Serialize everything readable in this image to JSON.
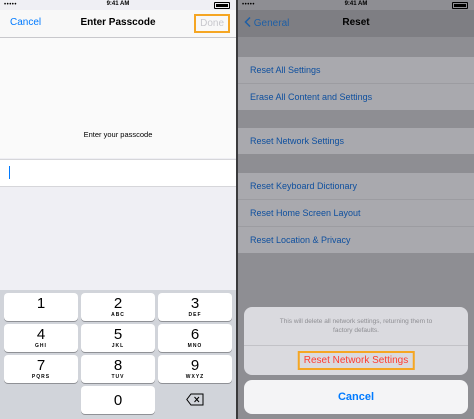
{
  "left": {
    "status": {
      "carrier": "•••••",
      "time": "9:41 AM"
    },
    "nav": {
      "cancel": "Cancel",
      "title": "Enter Passcode",
      "done": "Done"
    },
    "prompt": "Enter your passcode",
    "keys": [
      {
        "num": "1",
        "letters": ""
      },
      {
        "num": "2",
        "letters": "ABC"
      },
      {
        "num": "3",
        "letters": "DEF"
      },
      {
        "num": "4",
        "letters": "GHI"
      },
      {
        "num": "5",
        "letters": "JKL"
      },
      {
        "num": "6",
        "letters": "MNO"
      },
      {
        "num": "7",
        "letters": "PQRS"
      },
      {
        "num": "8",
        "letters": "TUV"
      },
      {
        "num": "9",
        "letters": "WXYZ"
      },
      {
        "num": "0",
        "letters": ""
      }
    ]
  },
  "right": {
    "status": {
      "carrier": "•••••",
      "time": "9:41 AM"
    },
    "nav": {
      "back": "General",
      "title": "Reset"
    },
    "group1": [
      "Reset All Settings",
      "Erase All Content and Settings"
    ],
    "group2": [
      "Reset Network Settings"
    ],
    "group3": [
      "Reset Keyboard Dictionary",
      "Reset Home Screen Layout",
      "Reset Location & Privacy"
    ],
    "sheet": {
      "message_line1": "This will delete all network settings, returning them to",
      "message_line2": "factory defaults.",
      "confirm": "Reset Network Settings",
      "cancel": "Cancel"
    }
  },
  "colors": {
    "accent": "#007aff",
    "destructive": "#ff3b30",
    "highlight": "#f5a623"
  }
}
